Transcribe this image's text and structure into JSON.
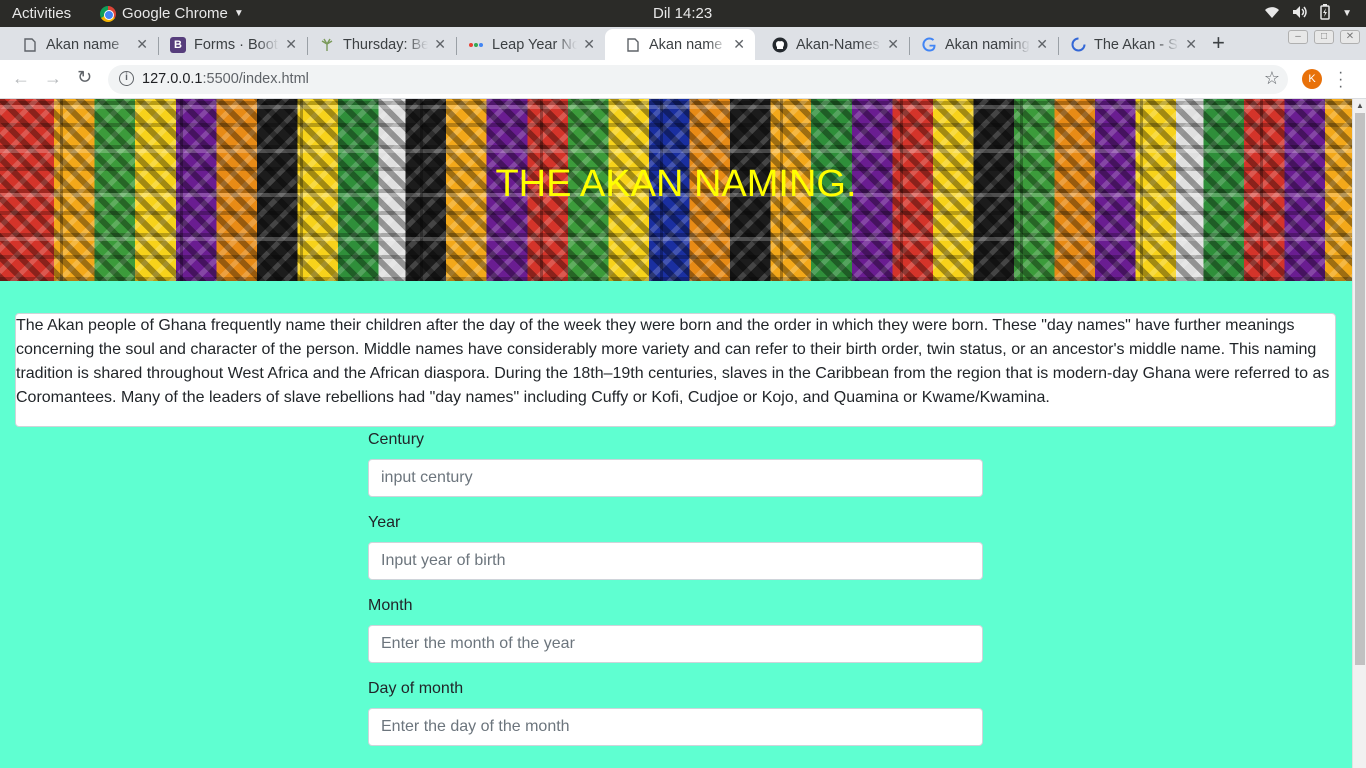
{
  "system": {
    "activities": "Activities",
    "app_name": "Google Chrome",
    "clock": "Dil 14:23"
  },
  "tabs": [
    {
      "title": "Akan name",
      "favicon": "page-icon",
      "active": false
    },
    {
      "title": "Forms · Bootstrap",
      "favicon": "bootstrap-icon",
      "active": false
    },
    {
      "title": "Thursday: Be",
      "favicon": "palm-icon",
      "active": false
    },
    {
      "title": "Leap Year No",
      "favicon": "dots-icon",
      "active": false
    },
    {
      "title": "Akan name",
      "favicon": "page-icon",
      "active": true
    },
    {
      "title": "Akan-Names",
      "favicon": "github-icon",
      "active": false
    },
    {
      "title": "Akan naming",
      "favicon": "google-icon",
      "active": false
    },
    {
      "title": "The Akan - Sc",
      "favicon": "loading-icon",
      "active": false
    }
  ],
  "omnibox": {
    "host": "127.0.0.1",
    "path": ":5500/index.html"
  },
  "profile_initial": "K",
  "page": {
    "banner_title": "THE AKAN NAMING.",
    "intro": "The Akan people of Ghana frequently name their children after the day of the week they were born and the order in which they were born. These \"day names\" have further meanings concerning the soul and character of the person. Middle names have considerably more variety and can refer to their birth order, twin status, or an ancestor's middle name. This naming tradition is shared throughout West Africa and the African diaspora. During the 18th–19th centuries, slaves in the Caribbean from the region that is modern-day Ghana were referred to as Coromantees. Many of the leaders of slave rebellions had \"day names\" including Cuffy or Kofi, Cudjoe or Kojo, and Quamina or Kwame/Kwamina.",
    "form": {
      "century": {
        "label": "Century",
        "placeholder": "input century"
      },
      "year": {
        "label": "Year",
        "placeholder": "Input year of birth"
      },
      "month": {
        "label": "Month",
        "placeholder": "Enter the month of the year"
      },
      "day": {
        "label": "Day of month",
        "placeholder": "Enter the day of the month"
      }
    }
  },
  "colors": {
    "page_background": "#5fffd1",
    "banner_title": "#ffff00",
    "profile_avatar": "#e8710a"
  }
}
